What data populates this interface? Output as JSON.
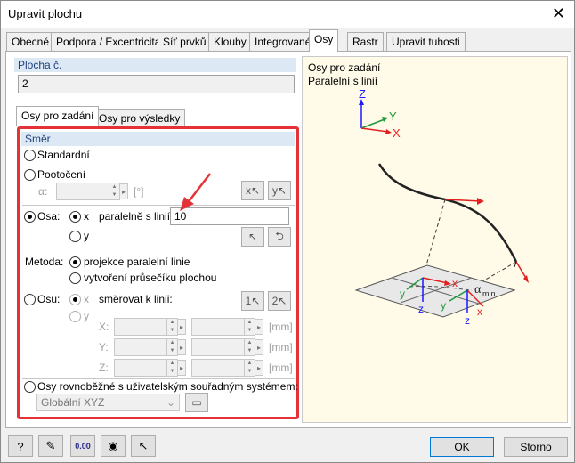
{
  "window": {
    "title": "Upravit plochu",
    "close_glyph": "✕"
  },
  "tabs": [
    "Obecné",
    "Podpora / Excentricita",
    "Síť prvků",
    "Klouby",
    "Integrované",
    "Osy",
    "Rastr",
    "Upravit tuhosti"
  ],
  "active_tab": "Osy",
  "surface": {
    "label": "Plocha č.",
    "value": "2"
  },
  "subtabs": [
    "Osy pro zadání",
    "Osy pro výsledky"
  ],
  "direction": {
    "group_label": "Směr",
    "standard_label": "Standardní",
    "rotation_label": "Pootočení",
    "alpha_label": "α:",
    "alpha_unit": "[°]",
    "axis_label": "Osa:",
    "axis_x": "x",
    "axis_y": "y",
    "parallel_label": "paralelně s linií:",
    "parallel_value": "10",
    "method_label": "Metoda:",
    "method_opt1": "projekce paralelní linie",
    "method_opt2": "vytvoření průsečíku plochou",
    "axis2_label": "Osu:",
    "axis2_x": "x",
    "axis2_y": "y",
    "direct_label": "směrovat k linii:",
    "coord_x": "X:",
    "coord_y": "Y:",
    "coord_z": "Z:",
    "unit_mm": "[mm]",
    "ucs_label": "Osy rovnoběžné s uživatelským souřadným systémem:",
    "ucs_value": "Globální XYZ"
  },
  "diagram": {
    "line1": "Osy pro zadání",
    "line2": "Paralelní s linií",
    "axis_Z": "Z",
    "axis_Y": "Y",
    "axis_X": "X",
    "local_x": "x",
    "local_y": "y",
    "local_z": "z",
    "alpha_min": "α",
    "alpha_sub": "min"
  },
  "buttons": {
    "ok": "OK",
    "cancel": "Storno"
  },
  "bottom_icon_value": "0.00",
  "colors": {
    "highlight_red": "#e53238",
    "axis_blue": "#1a1aff",
    "axis_green": "#1e9a3a",
    "axis_red": "#e32020"
  }
}
